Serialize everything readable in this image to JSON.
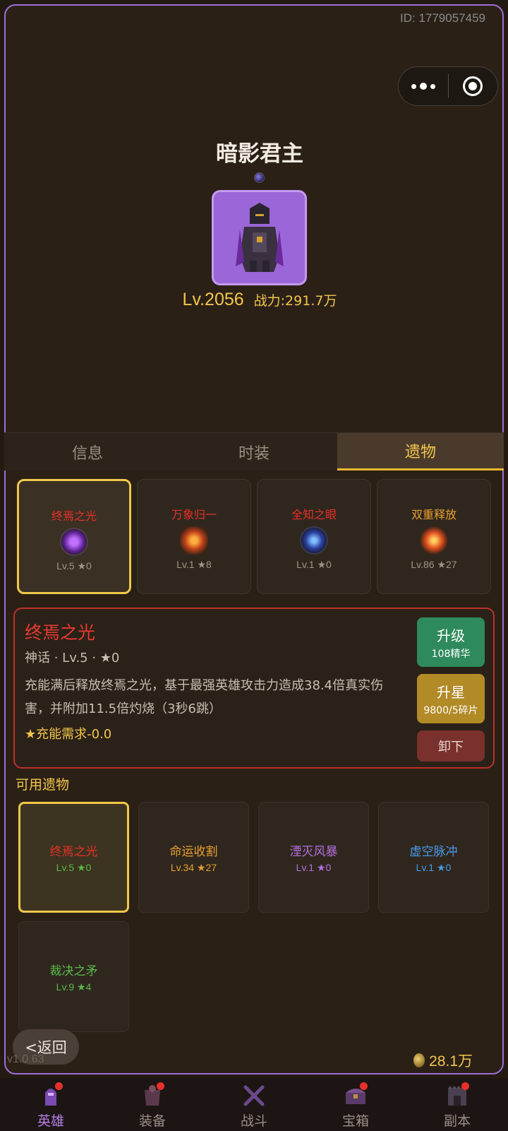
{
  "header": {
    "user_id": "ID: 1779057459"
  },
  "hero": {
    "name": "暗影君主",
    "level": "Lv.2056",
    "power": "战力:291.7万"
  },
  "tabs": [
    {
      "label": "信息",
      "active": false
    },
    {
      "label": "时装",
      "active": false
    },
    {
      "label": "遗物",
      "active": true
    }
  ],
  "equipped_relics": [
    {
      "name": "终焉之光",
      "stats": "Lv.5 ★0",
      "color": "#e8302a",
      "icon": "purple-orb-icon",
      "selected": true
    },
    {
      "name": "万象归一",
      "stats": "Lv.1 ★8",
      "color": "#e8302a",
      "icon": "fire-heart-icon",
      "selected": false
    },
    {
      "name": "全知之眼",
      "stats": "Lv.1 ★0",
      "color": "#e8302a",
      "icon": "blue-eye-icon",
      "selected": false
    },
    {
      "name": "双重释放",
      "stats": "Lv.86 ★27",
      "color": "#e8a030",
      "icon": "fire-spiral-icon",
      "selected": false
    }
  ],
  "detail": {
    "name": "终焉之光",
    "meta": "神话 · Lv.5 · ★0",
    "description": "充能满后释放终焉之光，基于最强英雄攻击力造成38.4倍真实伤害，并附加11.5倍灼烧（3秒6跳）",
    "requirement": "★充能需求-0.0",
    "upgrade_label": "升级",
    "upgrade_cost": "108精华",
    "star_label": "升星",
    "star_cost": "9800/5碎片",
    "unequip_label": "卸下"
  },
  "available": {
    "title": "可用遗物",
    "items": [
      {
        "name": "终焉之光",
        "stats": "Lv.5 ★0",
        "name_color": "#e8302a",
        "stats_color": "#5ab84a",
        "selected": true
      },
      {
        "name": "命运收割",
        "stats": "Lv.34 ★27",
        "name_color": "#e8a030",
        "stats_color": "#e8a030",
        "selected": false
      },
      {
        "name": "湮灭风暴",
        "stats": "Lv.1 ★0",
        "name_color": "#b56fe0",
        "stats_color": "#b56fe0",
        "selected": false
      },
      {
        "name": "虚空脉冲",
        "stats": "Lv.1 ★0",
        "name_color": "#4a9ae8",
        "stats_color": "#4a9ae8",
        "selected": false
      },
      {
        "name": "裁决之矛",
        "stats": "Lv.9 ★4",
        "name_color": "#5ab84a",
        "stats_color": "#5ab84a",
        "selected": false
      }
    ]
  },
  "footer": {
    "back_label": "<返回",
    "version": "v1.0.63",
    "currency": "28.1万"
  },
  "nav": [
    {
      "label": "英雄",
      "icon": "hero-icon",
      "active": true,
      "badge": true
    },
    {
      "label": "装备",
      "icon": "equipment-icon",
      "active": false,
      "badge": true
    },
    {
      "label": "战斗",
      "icon": "battle-icon",
      "active": false,
      "badge": false
    },
    {
      "label": "宝箱",
      "icon": "chest-icon",
      "active": false,
      "badge": true
    },
    {
      "label": "副本",
      "icon": "dungeon-icon",
      "active": false,
      "badge": true
    }
  ]
}
